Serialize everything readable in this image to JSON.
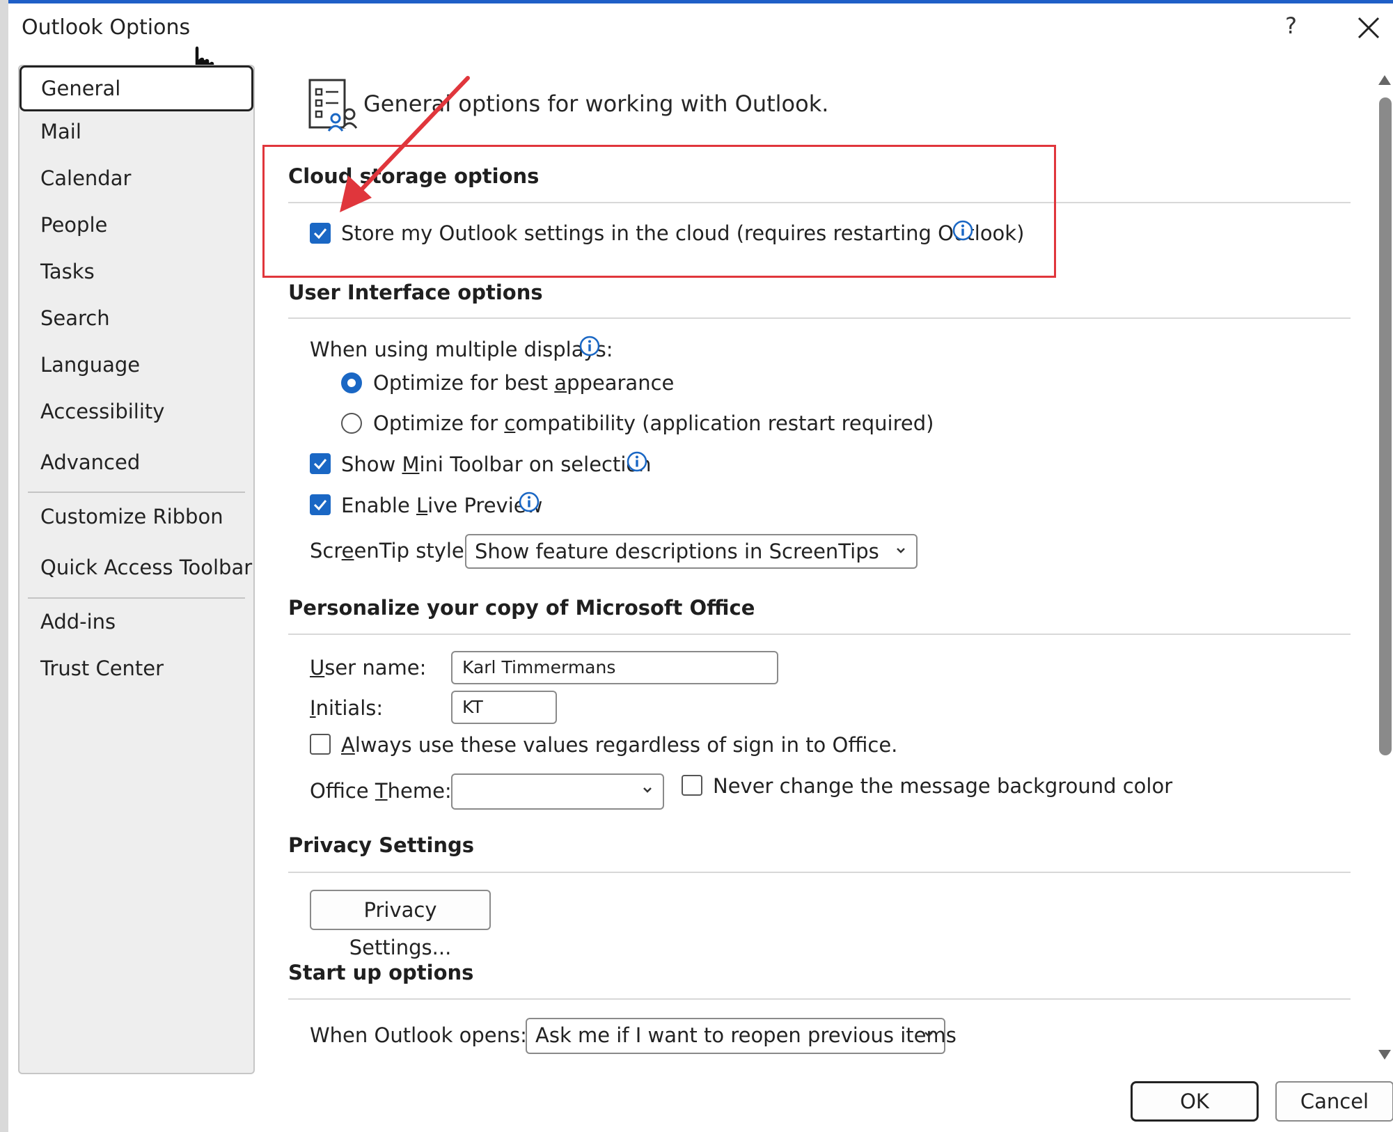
{
  "window": {
    "title": "Outlook Options",
    "help_label": "?",
    "close_icon": "close-icon"
  },
  "sidebar": {
    "items": [
      {
        "label": "General",
        "selected": true
      },
      {
        "label": "Mail"
      },
      {
        "label": "Calendar"
      },
      {
        "label": "People"
      },
      {
        "label": "Tasks"
      },
      {
        "label": "Search"
      },
      {
        "label": "Language"
      },
      {
        "label": "Accessibility"
      },
      {
        "label": "Advanced"
      },
      {
        "label": "Customize Ribbon"
      },
      {
        "label": "Quick Access Toolbar"
      },
      {
        "label": "Add-ins"
      },
      {
        "label": "Trust Center"
      }
    ]
  },
  "header": {
    "text": "General options for working with Outlook.",
    "icon": "general-options-icon"
  },
  "cloud": {
    "title": "Cloud storage options",
    "store_settings_label": "Store my Outlook settings in the cloud (requires restarting Outlook)",
    "store_settings_checked": true
  },
  "ui_options": {
    "title": "User Interface options",
    "multiple_displays_label": "When using multiple displays:",
    "radio_best": {
      "pre": "Optimize for best ",
      "ul": "a",
      "post": "ppearance",
      "selected": true
    },
    "radio_compat": {
      "pre": "Optimize for ",
      "ul": "c",
      "post": "ompatibility (application restart required)",
      "selected": false
    },
    "mini_toolbar": {
      "pre": "Show ",
      "ul": "M",
      "post": "ini Toolbar on selection",
      "checked": true
    },
    "live_preview": {
      "pre": "Enable ",
      "ul": "L",
      "post": "ive Preview",
      "checked": true
    },
    "screentip": {
      "pre": "Scr",
      "ul": "e",
      "post": "enTip style:",
      "value": "Show feature descriptions in ScreenTips"
    }
  },
  "personalize": {
    "title": "Personalize your copy of Microsoft Office",
    "user_name": {
      "ul": "U",
      "post": "ser name:",
      "value": "Karl Timmermans"
    },
    "initials": {
      "ul": "I",
      "post": "nitials:",
      "value": "KT"
    },
    "always_use": {
      "ul": "A",
      "post": "lways use these values regardless of sign in to Office.",
      "checked": false
    },
    "office_theme": {
      "pre": "Office ",
      "ul": "T",
      "post": "heme:",
      "value": ""
    },
    "never_change_bg": {
      "label": "Never change the message background color",
      "checked": false
    }
  },
  "privacy": {
    "title": "Privacy Settings",
    "button_label": "Privacy Settings..."
  },
  "startup": {
    "title": "Start up options",
    "when_opens_label": "When Outlook opens:",
    "when_opens_value": "Ask me if I want to reopen previous items"
  },
  "footer": {
    "ok_label": "OK",
    "cancel_label": "Cancel"
  },
  "colors": {
    "accent": "#1a67c4",
    "annotation": "#e0363c",
    "title_bar": "#1f5fc7"
  }
}
